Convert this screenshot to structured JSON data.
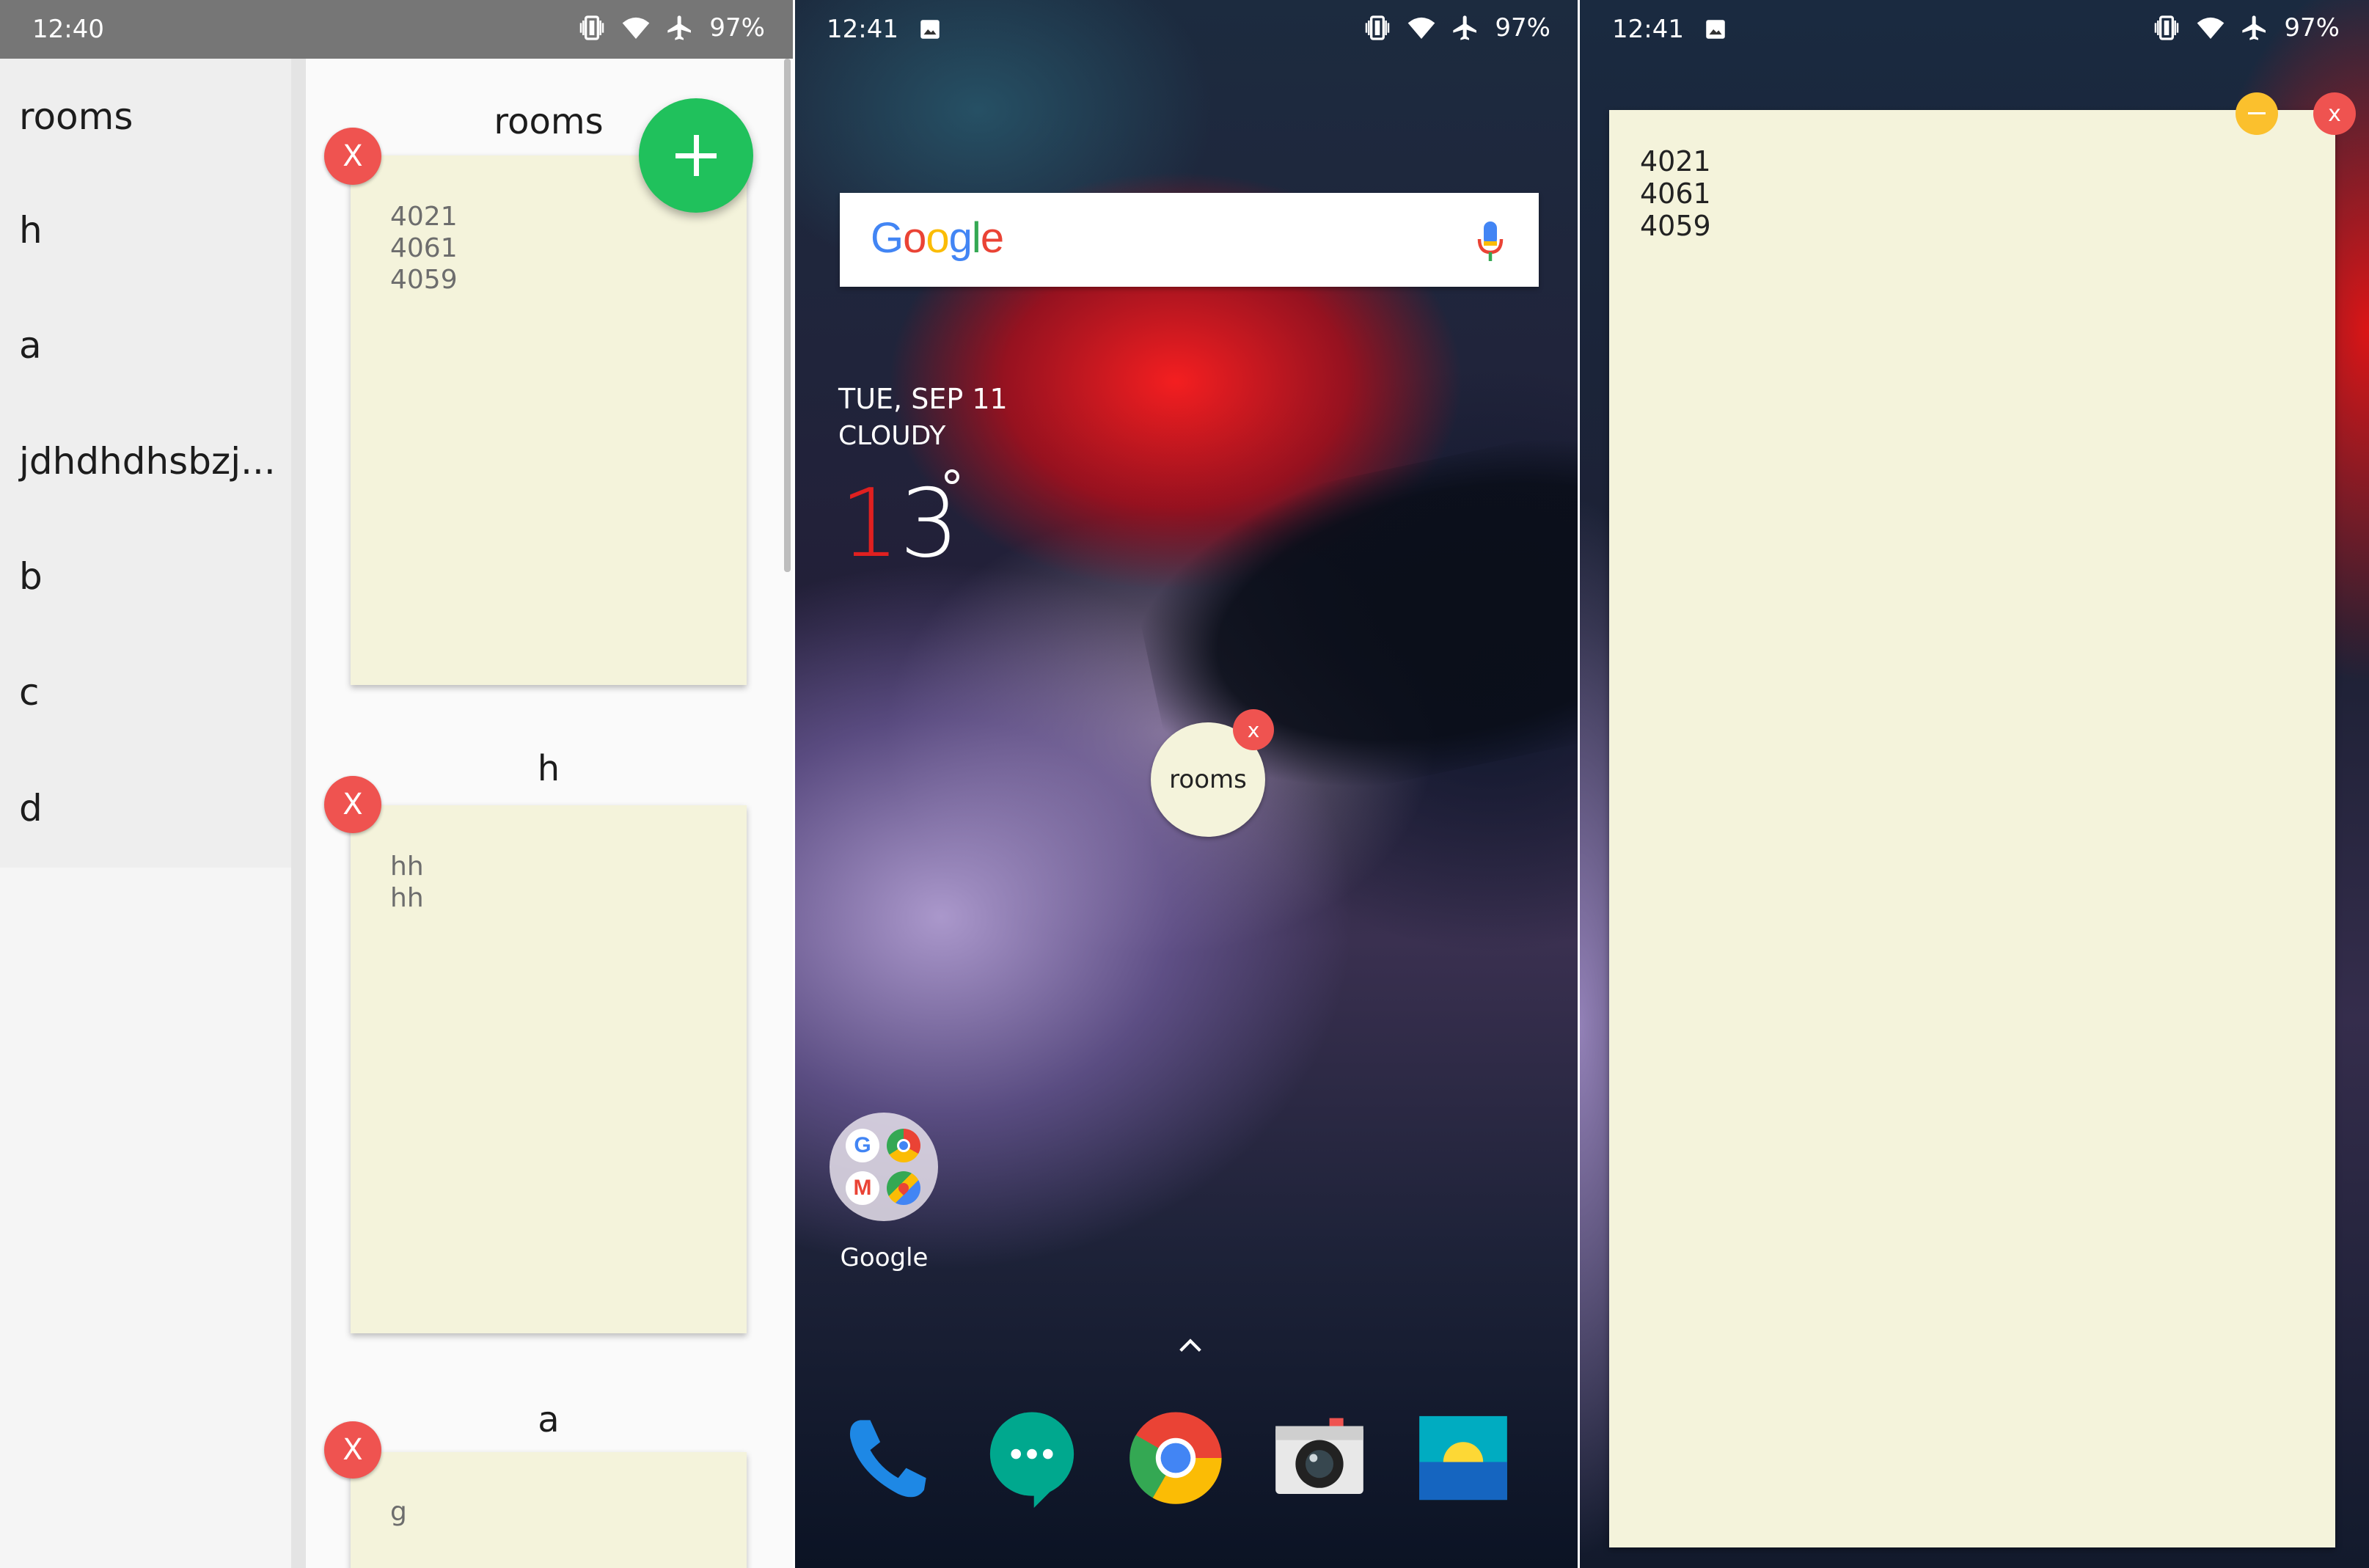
{
  "panel1": {
    "status": {
      "time": "12:40",
      "battery": "97%"
    },
    "sidebar": {
      "items": [
        {
          "label": "rooms"
        },
        {
          "label": "h"
        },
        {
          "label": "a"
        },
        {
          "label": "jdhdhdhsbzj..."
        },
        {
          "label": "b"
        },
        {
          "label": "c"
        },
        {
          "label": "d"
        }
      ]
    },
    "notes": [
      {
        "title": "rooms",
        "lines": [
          "4021",
          "4061",
          "4059"
        ],
        "delete": "X"
      },
      {
        "title": "h",
        "lines": [
          "hh",
          "hh"
        ],
        "delete": "X"
      },
      {
        "title": "a",
        "lines": [
          "g"
        ],
        "delete": "X"
      }
    ],
    "fab_icon": "plus-icon"
  },
  "panel2": {
    "status": {
      "time": "12:41",
      "battery": "97%"
    },
    "search": {
      "logo": "Google",
      "mic_icon": "mic-icon"
    },
    "weather": {
      "date": "TUE, SEP 11",
      "condition": "CLOUDY",
      "temp_first": "1",
      "temp_second": "3"
    },
    "bubble": {
      "label": "rooms",
      "close": "x"
    },
    "folder": {
      "label": "Google"
    },
    "dock": [
      "phone-icon",
      "messages-icon",
      "chrome-icon",
      "camera-icon",
      "gallery-icon"
    ]
  },
  "panel3": {
    "status": {
      "time": "12:41",
      "battery": "97%"
    },
    "note": {
      "lines": [
        "4021",
        "4061",
        "4059"
      ],
      "close": "x"
    }
  },
  "colors": {
    "note_bg": "#f4f3db",
    "delete_red": "#ef5350",
    "fab_green": "#20c15c",
    "minimize_yellow": "#fbc02d"
  }
}
